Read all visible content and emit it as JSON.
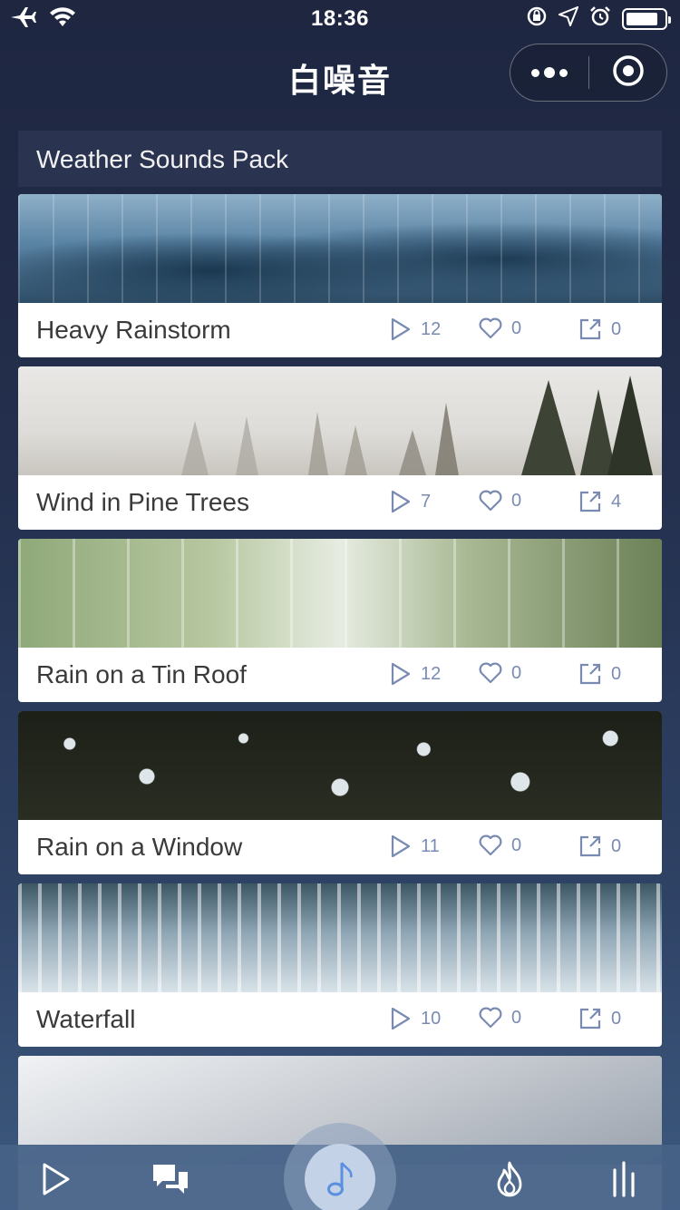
{
  "status_bar": {
    "time": "18:36",
    "left_icons": [
      "airplane-icon",
      "wifi-icon"
    ],
    "right_icons": [
      "rotation-lock-icon",
      "location-icon",
      "alarm-icon",
      "battery-icon"
    ]
  },
  "nav": {
    "title": "白噪音",
    "more_icon": "more-icon",
    "close_icon": "target-icon"
  },
  "section": {
    "title": "Weather Sounds Pack"
  },
  "cards": [
    {
      "title": "Heavy Rainstorm",
      "plays": "12",
      "likes": "0",
      "shares": "0"
    },
    {
      "title": "Wind in Pine Trees",
      "plays": "7",
      "likes": "0",
      "shares": "4"
    },
    {
      "title": "Rain on a Tin Roof",
      "plays": "12",
      "likes": "0",
      "shares": "0"
    },
    {
      "title": "Rain on a Window",
      "plays": "11",
      "likes": "0",
      "shares": "0"
    },
    {
      "title": "Waterfall",
      "plays": "10",
      "likes": "0",
      "shares": "0"
    }
  ],
  "tabbar": {
    "items": [
      "play-icon",
      "chat-icon",
      "music-note-icon",
      "fire-icon",
      "bars-icon"
    ],
    "active": "music-note-icon",
    "accent": "#5b8fe0"
  }
}
